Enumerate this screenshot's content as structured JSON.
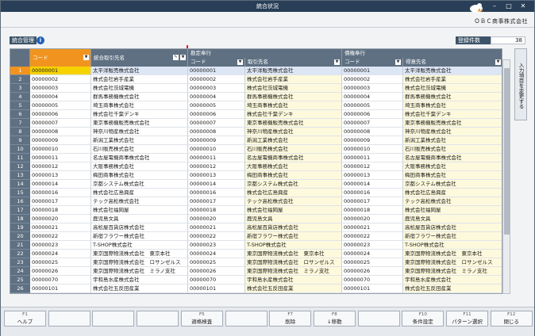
{
  "window": {
    "title": "統合状況",
    "company": "ＯＢＣ商事株式会社"
  },
  "panel": {
    "label": "統合管理",
    "info": "i",
    "count_label": "登録件数",
    "count_value": "38"
  },
  "side_tab": "入力項目を変更する",
  "columns": {
    "col1": "コード",
    "col2": "統合取引先名",
    "group1": "勘定奉行",
    "col3": "コード",
    "col4": "取引先名",
    "group2": "債権奉行",
    "col5": "コード",
    "col6": "得意先名"
  },
  "rows": [
    {
      "n": "1",
      "code": "00000001",
      "name": "太平洋販売株式会社",
      "code2": "00000001",
      "name2": "太平洋販売株式会社",
      "code3": "00000001",
      "name3": "太平洋販売株式会社"
    },
    {
      "n": "2",
      "code": "00000002",
      "name": "株式会社岩手産業",
      "code2": "00000002",
      "name2": "株式会社岩手産業",
      "code3": "00000002",
      "name3": "株式会社岩手産業"
    },
    {
      "n": "3",
      "code": "00000003",
      "name": "株式会社茨城電機",
      "code2": "00000003",
      "name2": "株式会社茨城電機",
      "code3": "00000003",
      "name3": "株式会社茨城電機"
    },
    {
      "n": "4",
      "code": "00000004",
      "name": "群馬事務機株式会社",
      "code2": "00000004",
      "name2": "群馬事務機株式会社",
      "code3": "00000004",
      "name3": "群馬事務機株式会社"
    },
    {
      "n": "5",
      "code": "00000005",
      "name": "埼玉商事株式会社",
      "code2": "00000005",
      "name2": "埼玉商事株式会社",
      "code3": "00000005",
      "name3": "埼玉商事株式会社"
    },
    {
      "n": "6",
      "code": "00000006",
      "name": "株式会社千葉デンキ",
      "code2": "00000006",
      "name2": "株式会社千葉デンキ",
      "code3": "00000006",
      "name3": "株式会社千葉デンキ"
    },
    {
      "n": "7",
      "code": "00000007",
      "name": "東京事務機販売株式会社",
      "code2": "00000007",
      "name2": "東京事務機販売株式会社",
      "code3": "00000007",
      "name3": "東京事務機販売株式会社"
    },
    {
      "n": "8",
      "code": "00000008",
      "name": "神奈川物産株式会社",
      "code2": "00000008",
      "name2": "神奈川物産株式会社",
      "code3": "00000008",
      "name3": "神奈川物産株式会社"
    },
    {
      "n": "9",
      "code": "00000009",
      "name": "新潟工業株式会社",
      "code2": "00000009",
      "name2": "新潟工業株式会社",
      "code3": "00000009",
      "name3": "新潟工業株式会社"
    },
    {
      "n": "10",
      "code": "00000010",
      "name": "石川販売株式会社",
      "code2": "00000010",
      "name2": "石川販売株式会社",
      "code3": "00000010",
      "name3": "石川販売株式会社"
    },
    {
      "n": "11",
      "code": "00000011",
      "name": "名古屋電機商事株式会社",
      "code2": "00000011",
      "name2": "名古屋電機商事株式会社",
      "code3": "00000011",
      "name3": "名古屋電機商事株式会社"
    },
    {
      "n": "12",
      "code": "00000012",
      "name": "大阪事務株式会社",
      "code2": "00000012",
      "name2": "大阪事務株式会社",
      "code3": "00000012",
      "name3": "大阪事務株式会社"
    },
    {
      "n": "13",
      "code": "00000013",
      "name": "梅田商事株式会社",
      "code2": "00000013",
      "name2": "梅田商事株式会社",
      "code3": "00000013",
      "name3": "梅田商事株式会社"
    },
    {
      "n": "14",
      "code": "00000014",
      "name": "京都システム株式会社",
      "code2": "00000014",
      "name2": "京都システム株式会社",
      "code3": "00000014",
      "name3": "京都システム株式会社"
    },
    {
      "n": "15",
      "code": "00000016",
      "name": "株式会社広島興産",
      "code2": "00000016",
      "name2": "株式会社広島興産",
      "code3": "00000016",
      "name3": "株式会社広島興産"
    },
    {
      "n": "16",
      "code": "00000017",
      "name": "テック高松株式会社",
      "code2": "00000017",
      "name2": "テック高松株式会社",
      "code3": "00000017",
      "name3": "テック高松株式会社"
    },
    {
      "n": "17",
      "code": "00000018",
      "name": "株式会社福岡屋",
      "code2": "00000018",
      "name2": "株式会社福岡屋",
      "code3": "00000018",
      "name3": "株式会社福岡屋"
    },
    {
      "n": "18",
      "code": "00000020",
      "name": "鹿児島文具",
      "code2": "00000020",
      "name2": "鹿児島文具",
      "code3": "00000020",
      "name3": "鹿児島文具"
    },
    {
      "n": "19",
      "code": "00000021",
      "name": "高松屋百貨店株式会社",
      "code2": "00000021",
      "name2": "高松屋百貨店株式会社",
      "code3": "00000021",
      "name3": "高松屋百貨店株式会社"
    },
    {
      "n": "20",
      "code": "00000022",
      "name": "新宿フラワー株式会社",
      "code2": "00000022",
      "name2": "新宿フラワー株式会社",
      "code3": "00000022",
      "name3": "新宿フラワー株式会社"
    },
    {
      "n": "21",
      "code": "00000023",
      "name": "T-SHOP株式会社",
      "code2": "00000023",
      "name2": "T-SHOP株式会社",
      "code3": "00000023",
      "name3": "T-SHOP株式会社"
    },
    {
      "n": "22",
      "code": "00000024",
      "name": "東京国際物流株式会社　東京本社",
      "code2": "00000024",
      "name2": "東京国際物流株式会社　東京本社",
      "code3": "00000024",
      "name3": "東京国際物流株式会社　東京本社"
    },
    {
      "n": "23",
      "code": "00000025",
      "name": "東京国際物流株式会社　ロサンゼルス",
      "code2": "00000025",
      "name2": "東京国際物流株式会社　ロサンゼルス",
      "code3": "00000025",
      "name3": "東京国際物流株式会社　ロサンゼルス"
    },
    {
      "n": "24",
      "code": "00000026",
      "name": "東京国際物流株式会社　ミラノ支社",
      "code2": "00000026",
      "name2": "東京国際物流株式会社　ミラノ支社",
      "code3": "00000026",
      "name3": "東京国際物流株式会社　ミラノ支社"
    },
    {
      "n": "25",
      "code": "00000070",
      "name": "宇和島水産株式会社",
      "code2": "00000070",
      "name2": "宇和島水産株式会社",
      "code3": "00000070",
      "name3": "宇和島水産株式会社"
    },
    {
      "n": "26",
      "code": "00000101",
      "name": "株式会社五反田産業",
      "code2": "00000101",
      "name2": "株式会社五反田産業",
      "code3": "00000101",
      "name3": "株式会社五反田産業"
    }
  ],
  "fkeys": [
    {
      "key": "F1",
      "label": "ヘルプ"
    },
    {
      "key": "",
      "label": ""
    },
    {
      "key": "",
      "label": ""
    },
    {
      "key": "",
      "label": ""
    },
    {
      "key": "F5",
      "label": "適格検査"
    },
    {
      "key": "",
      "label": ""
    },
    {
      "key": "F7",
      "label": "削除"
    },
    {
      "key": "F8",
      "label": "↓移動"
    },
    {
      "key": "",
      "label": ""
    },
    {
      "key": "F10",
      "label": "条件設定"
    },
    {
      "key": "F11",
      "label": "パターン選択"
    },
    {
      "key": "F12",
      "label": "閉じる"
    }
  ]
}
